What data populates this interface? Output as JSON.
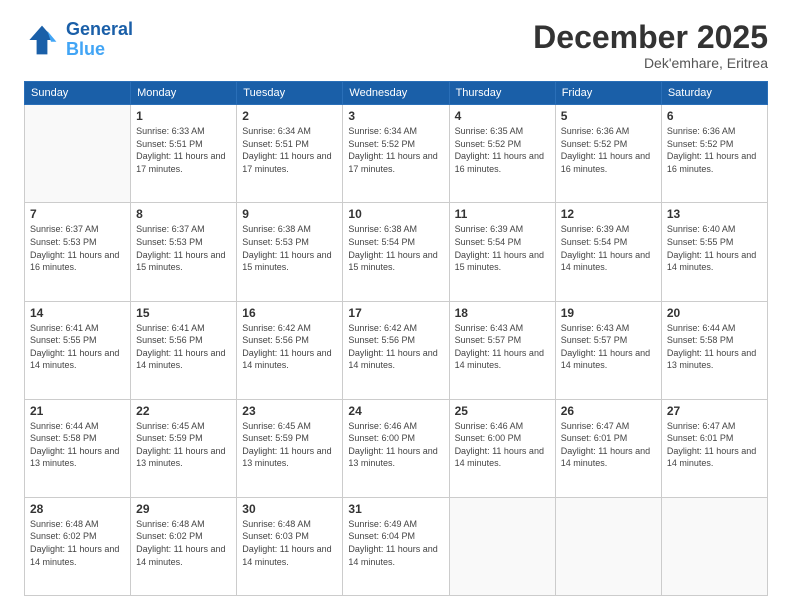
{
  "header": {
    "logo_line1": "General",
    "logo_line2": "Blue",
    "month": "December 2025",
    "location": "Dek'emhare, Eritrea"
  },
  "weekdays": [
    "Sunday",
    "Monday",
    "Tuesday",
    "Wednesday",
    "Thursday",
    "Friday",
    "Saturday"
  ],
  "weeks": [
    [
      {
        "day": "",
        "sunrise": "",
        "sunset": "",
        "daylight": ""
      },
      {
        "day": "1",
        "sunrise": "6:33 AM",
        "sunset": "5:51 PM",
        "daylight": "11 hours and 17 minutes."
      },
      {
        "day": "2",
        "sunrise": "6:34 AM",
        "sunset": "5:51 PM",
        "daylight": "11 hours and 17 minutes."
      },
      {
        "day": "3",
        "sunrise": "6:34 AM",
        "sunset": "5:52 PM",
        "daylight": "11 hours and 17 minutes."
      },
      {
        "day": "4",
        "sunrise": "6:35 AM",
        "sunset": "5:52 PM",
        "daylight": "11 hours and 16 minutes."
      },
      {
        "day": "5",
        "sunrise": "6:36 AM",
        "sunset": "5:52 PM",
        "daylight": "11 hours and 16 minutes."
      },
      {
        "day": "6",
        "sunrise": "6:36 AM",
        "sunset": "5:52 PM",
        "daylight": "11 hours and 16 minutes."
      }
    ],
    [
      {
        "day": "7",
        "sunrise": "6:37 AM",
        "sunset": "5:53 PM",
        "daylight": "11 hours and 16 minutes."
      },
      {
        "day": "8",
        "sunrise": "6:37 AM",
        "sunset": "5:53 PM",
        "daylight": "11 hours and 15 minutes."
      },
      {
        "day": "9",
        "sunrise": "6:38 AM",
        "sunset": "5:53 PM",
        "daylight": "11 hours and 15 minutes."
      },
      {
        "day": "10",
        "sunrise": "6:38 AM",
        "sunset": "5:54 PM",
        "daylight": "11 hours and 15 minutes."
      },
      {
        "day": "11",
        "sunrise": "6:39 AM",
        "sunset": "5:54 PM",
        "daylight": "11 hours and 15 minutes."
      },
      {
        "day": "12",
        "sunrise": "6:39 AM",
        "sunset": "5:54 PM",
        "daylight": "11 hours and 14 minutes."
      },
      {
        "day": "13",
        "sunrise": "6:40 AM",
        "sunset": "5:55 PM",
        "daylight": "11 hours and 14 minutes."
      }
    ],
    [
      {
        "day": "14",
        "sunrise": "6:41 AM",
        "sunset": "5:55 PM",
        "daylight": "11 hours and 14 minutes."
      },
      {
        "day": "15",
        "sunrise": "6:41 AM",
        "sunset": "5:56 PM",
        "daylight": "11 hours and 14 minutes."
      },
      {
        "day": "16",
        "sunrise": "6:42 AM",
        "sunset": "5:56 PM",
        "daylight": "11 hours and 14 minutes."
      },
      {
        "day": "17",
        "sunrise": "6:42 AM",
        "sunset": "5:56 PM",
        "daylight": "11 hours and 14 minutes."
      },
      {
        "day": "18",
        "sunrise": "6:43 AM",
        "sunset": "5:57 PM",
        "daylight": "11 hours and 14 minutes."
      },
      {
        "day": "19",
        "sunrise": "6:43 AM",
        "sunset": "5:57 PM",
        "daylight": "11 hours and 14 minutes."
      },
      {
        "day": "20",
        "sunrise": "6:44 AM",
        "sunset": "5:58 PM",
        "daylight": "11 hours and 13 minutes."
      }
    ],
    [
      {
        "day": "21",
        "sunrise": "6:44 AM",
        "sunset": "5:58 PM",
        "daylight": "11 hours and 13 minutes."
      },
      {
        "day": "22",
        "sunrise": "6:45 AM",
        "sunset": "5:59 PM",
        "daylight": "11 hours and 13 minutes."
      },
      {
        "day": "23",
        "sunrise": "6:45 AM",
        "sunset": "5:59 PM",
        "daylight": "11 hours and 13 minutes."
      },
      {
        "day": "24",
        "sunrise": "6:46 AM",
        "sunset": "6:00 PM",
        "daylight": "11 hours and 13 minutes."
      },
      {
        "day": "25",
        "sunrise": "6:46 AM",
        "sunset": "6:00 PM",
        "daylight": "11 hours and 14 minutes."
      },
      {
        "day": "26",
        "sunrise": "6:47 AM",
        "sunset": "6:01 PM",
        "daylight": "11 hours and 14 minutes."
      },
      {
        "day": "27",
        "sunrise": "6:47 AM",
        "sunset": "6:01 PM",
        "daylight": "11 hours and 14 minutes."
      }
    ],
    [
      {
        "day": "28",
        "sunrise": "6:48 AM",
        "sunset": "6:02 PM",
        "daylight": "11 hours and 14 minutes."
      },
      {
        "day": "29",
        "sunrise": "6:48 AM",
        "sunset": "6:02 PM",
        "daylight": "11 hours and 14 minutes."
      },
      {
        "day": "30",
        "sunrise": "6:48 AM",
        "sunset": "6:03 PM",
        "daylight": "11 hours and 14 minutes."
      },
      {
        "day": "31",
        "sunrise": "6:49 AM",
        "sunset": "6:04 PM",
        "daylight": "11 hours and 14 minutes."
      },
      {
        "day": "",
        "sunrise": "",
        "sunset": "",
        "daylight": ""
      },
      {
        "day": "",
        "sunrise": "",
        "sunset": "",
        "daylight": ""
      },
      {
        "day": "",
        "sunrise": "",
        "sunset": "",
        "daylight": ""
      }
    ]
  ]
}
